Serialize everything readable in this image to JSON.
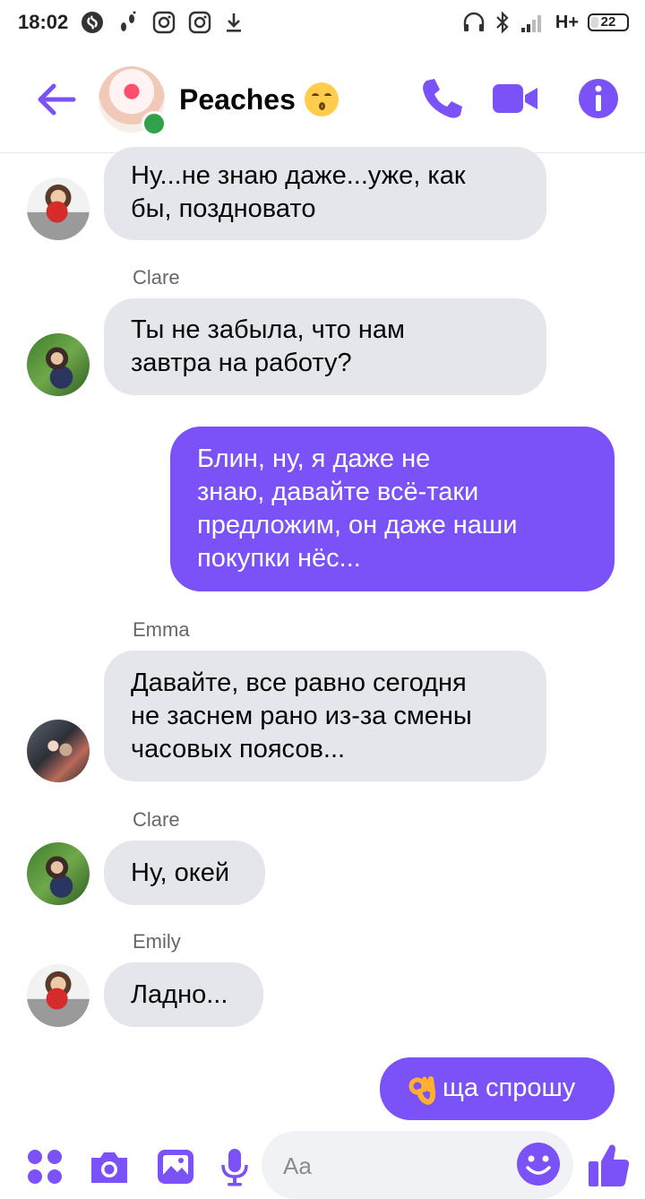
{
  "status_bar": {
    "time": "18:02",
    "network": "H+",
    "battery": "22",
    "battery_level": 0.22,
    "left_icons": [
      "shazam-icon",
      "walk-icon",
      "instagram-icon",
      "instagram-icon",
      "download-icon"
    ],
    "right_icons": [
      "headphones-icon",
      "bluetooth-icon",
      "signal-icon"
    ]
  },
  "header": {
    "title": "Peaches",
    "title_emoji": "kissing-face-emoji",
    "online": true,
    "accent_color": "#7b52f7",
    "icons": [
      "back-arrow-icon",
      "phone-icon",
      "video-camera-icon",
      "info-icon"
    ]
  },
  "messages": [
    {
      "direction": "in",
      "sender": "",
      "text_lines": [
        "Ну...не знаю даже...уже, как",
        "бы, поздновато"
      ],
      "avatar": "emily-avatar"
    },
    {
      "direction": "in",
      "sender": "Clare",
      "text_lines": [
        "Ты не забыла, что нам",
        "завтра на работу?"
      ],
      "avatar": "clare-avatar"
    },
    {
      "direction": "out",
      "sender": "",
      "text_lines": [
        "Блин, ну, я даже не",
        "знаю, давайте всё-таки",
        "предложим, он даже наши",
        "покупки нёс..."
      ]
    },
    {
      "direction": "in",
      "sender": "Emma",
      "text_lines": [
        "Давайте, все равно сегодня",
        "не заснем рано из-за смены",
        "часовых поясов..."
      ],
      "avatar": "emma-avatar"
    },
    {
      "direction": "in",
      "sender": "Clare",
      "text_lines": [
        "Ну, окей"
      ],
      "avatar": "clare-avatar"
    },
    {
      "direction": "in",
      "sender": "Emily",
      "text_lines": [
        "Ладно..."
      ],
      "avatar": "emily-avatar"
    },
    {
      "direction": "out",
      "sender": "",
      "text_lines": [
        "ща спрошу"
      ],
      "emoji": "ok-hand-emoji"
    }
  ],
  "composer": {
    "placeholder": "Aa",
    "icons": [
      "menu-dots-icon",
      "camera-icon",
      "gallery-icon",
      "microphone-icon",
      "emoji-icon",
      "thumbs-up-icon"
    ]
  },
  "colors": {
    "incoming_bubble": "#e4e6eb",
    "outgoing_bubble": "#7b52f7",
    "sender_label": "#65676b"
  }
}
